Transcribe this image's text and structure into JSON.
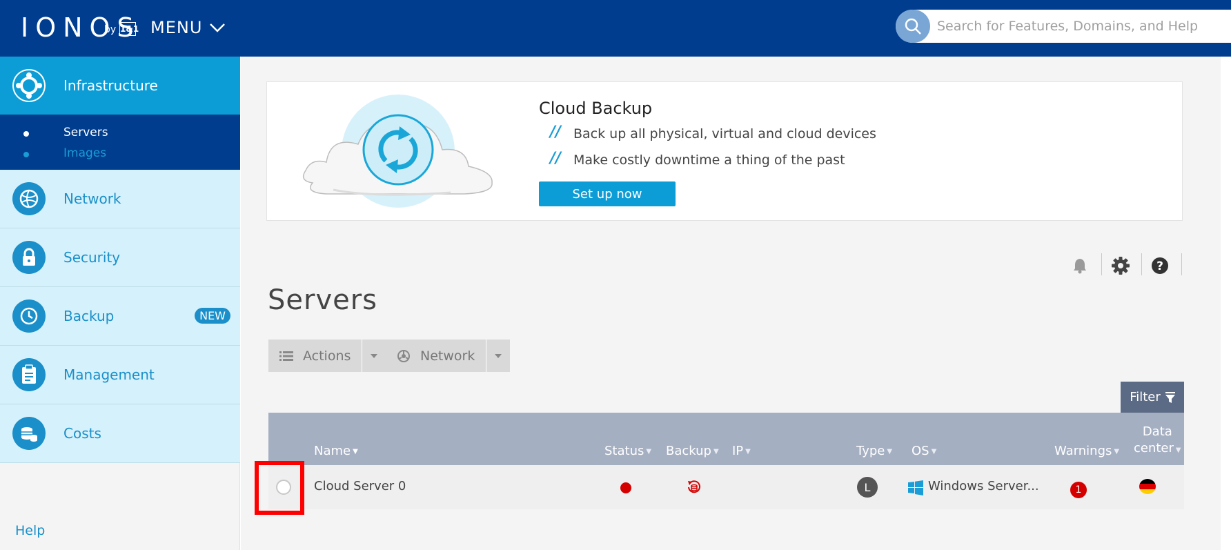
{
  "header": {
    "logo": "IONOS",
    "logo_by": "by",
    "logo_partner": "1&1",
    "menu_label": "MENU",
    "search_placeholder": "Search for Features, Domains, and Help"
  },
  "sidebar": {
    "active": {
      "label": "Infrastructure",
      "icon": "infrastructure-icon"
    },
    "subitems": [
      {
        "label": "Servers",
        "active": true
      },
      {
        "label": "Images",
        "active": false
      }
    ],
    "items": [
      {
        "label": "Network",
        "icon": "network-icon"
      },
      {
        "label": "Security",
        "icon": "lock-icon"
      },
      {
        "label": "Backup",
        "icon": "clock-icon",
        "badge": "NEW"
      },
      {
        "label": "Management",
        "icon": "clipboard-icon"
      },
      {
        "label": "Costs",
        "icon": "coins-icon"
      }
    ],
    "help_label": "Help"
  },
  "promo": {
    "title": "Cloud Backup",
    "bullets": [
      "Back up all physical, virtual and cloud devices",
      "Make costly downtime a thing of the past"
    ],
    "button_label": "Set up now"
  },
  "main": {
    "title": "Servers",
    "actions_label": "Actions",
    "network_label": "Network",
    "filter_label": "Filter"
  },
  "table": {
    "columns": {
      "name": "Name",
      "status": "Status",
      "backup": "Backup",
      "ip": "IP",
      "type": "Type",
      "os": "OS",
      "warnings": "Warnings",
      "datacenter_line1": "Data",
      "datacenter_line2": "center"
    },
    "rows": [
      {
        "name": "Cloud Server 0",
        "status_color": "#d40000",
        "type": "L",
        "os": "Windows Server...",
        "warnings": "1"
      }
    ]
  },
  "colors": {
    "header": "#003d8f",
    "accent": "#0d9dd6",
    "sidebar_item_bg": "#d5f1fb",
    "table_header": "#a5afc2",
    "filter_button": "#5c6b85",
    "alert": "#d40000"
  }
}
